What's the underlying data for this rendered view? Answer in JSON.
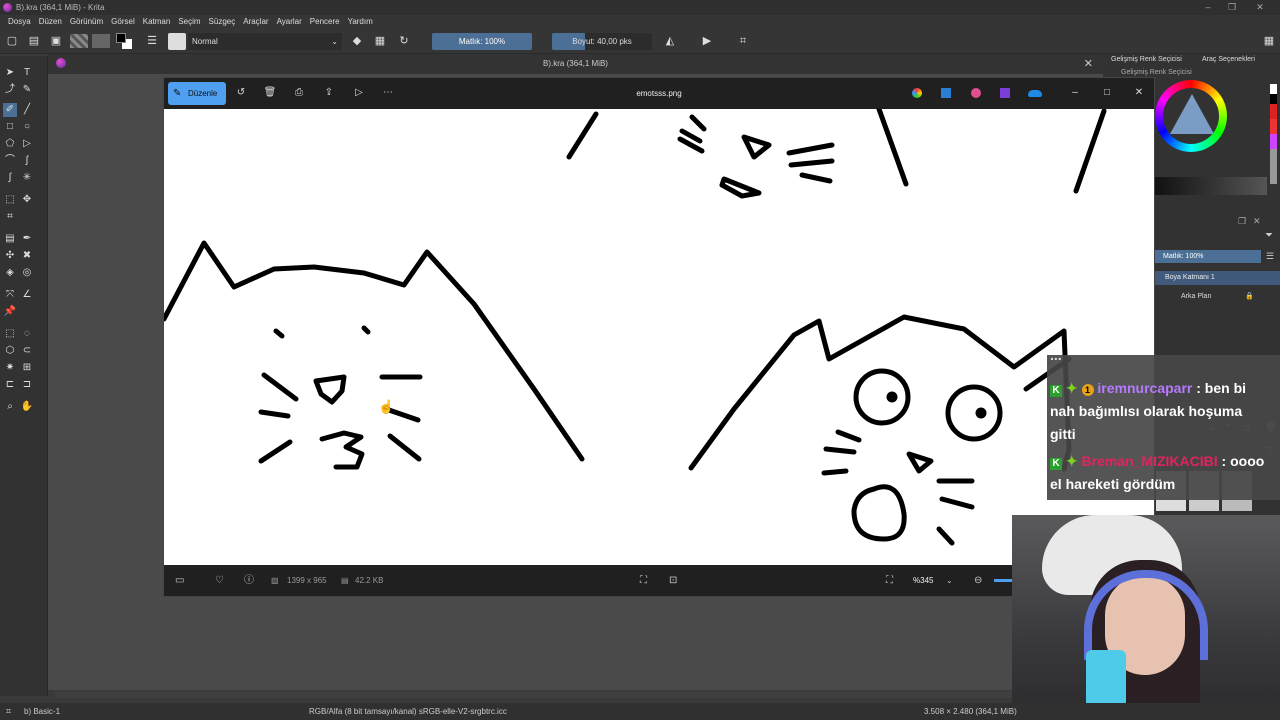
{
  "window": {
    "title": "B).kra (364,1 MiB) - Krita"
  },
  "menu": [
    "Dosya",
    "Düzen",
    "Görünüm",
    "Görsel",
    "Katman",
    "Seçim",
    "Süzgeç",
    "Araçlar",
    "Ayarlar",
    "Pencere",
    "Yardım"
  ],
  "toolbar": {
    "blend_mode": "Normal",
    "opacity": "Matlık: 100%",
    "size": "Boyut: 40,00 pks"
  },
  "document_tab": {
    "title": "B).kra (364,1 MiB)"
  },
  "docker": {
    "tab1": "Gelişmiş Renk Seçicisi",
    "tab2": "Araç Seçenekleri",
    "sub_title": "Gelişmiş Renk Seçicisi",
    "layer_opacity": "Matlık: 100%",
    "layers": [
      {
        "name": "Boya Katmanı 1"
      },
      {
        "name": "Arka Plan"
      }
    ]
  },
  "viewer": {
    "edit_label": "Düzenle",
    "filename": "emotsss.png",
    "dimensions": "1399 x 965",
    "filesize": "42.2 KB",
    "zoom": "%345",
    "colors": {
      "accent": "#4f9ff0",
      "bg": "#202020"
    }
  },
  "chat": {
    "partial": "...",
    "messages": [
      {
        "user": "iremnurcaparr",
        "user_color": "#b57bff",
        "text": ": ben bi",
        "cont1": "nah bağımlısı olarak hoşuma",
        "cont2": "gitti"
      },
      {
        "user": "Breman_MIZIKACIBI",
        "user_color": "#e0245e",
        "text": ": oooo",
        "cont1": "el hareketi gördüm"
      }
    ]
  },
  "statusbar": {
    "brush": "b) Basic-1",
    "color_info": "RGB/Alfa (8 bit tamsayı/kanal)  sRGB-elle-V2-srgbtrc.icc",
    "doc_info": "3.508 × 2.480 (364,1 MiB)"
  }
}
